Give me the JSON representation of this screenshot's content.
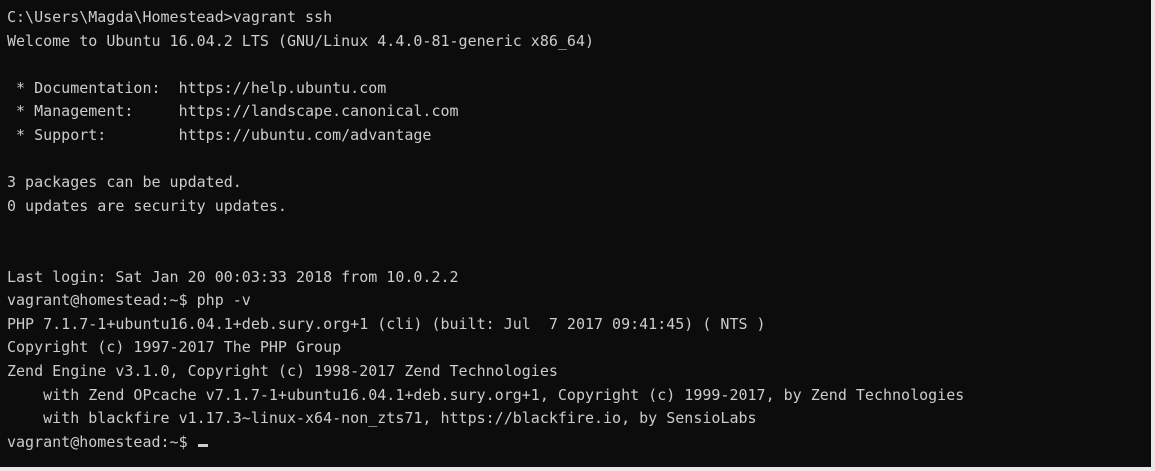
{
  "terminal": {
    "lines": [
      "C:\\Users\\Magda\\Homestead>vagrant ssh",
      "Welcome to Ubuntu 16.04.2 LTS (GNU/Linux 4.4.0-81-generic x86_64)",
      "",
      " * Documentation:  https://help.ubuntu.com",
      " * Management:     https://landscape.canonical.com",
      " * Support:        https://ubuntu.com/advantage",
      "",
      "3 packages can be updated.",
      "0 updates are security updates.",
      "",
      "",
      "Last login: Sat Jan 20 00:03:33 2018 from 10.0.2.2",
      "vagrant@homestead:~$ php -v",
      "PHP 7.1.7-1+ubuntu16.04.1+deb.sury.org+1 (cli) (built: Jul  7 2017 09:41:45) ( NTS )",
      "Copyright (c) 1997-2017 The PHP Group",
      "Zend Engine v3.1.0, Copyright (c) 1998-2017 Zend Technologies",
      "    with Zend OPcache v7.1.7-1+ubuntu16.04.1+deb.sury.org+1, Copyright (c) 1999-2017, by Zend Technologies",
      "    with blackfire v1.17.3~linux-x64-non_zts71, https://blackfire.io, by SensioLabs"
    ],
    "prompt": "vagrant@homestead:~$ ",
    "colors": {
      "background": "#0c0c0c",
      "foreground": "#cccccc"
    }
  }
}
